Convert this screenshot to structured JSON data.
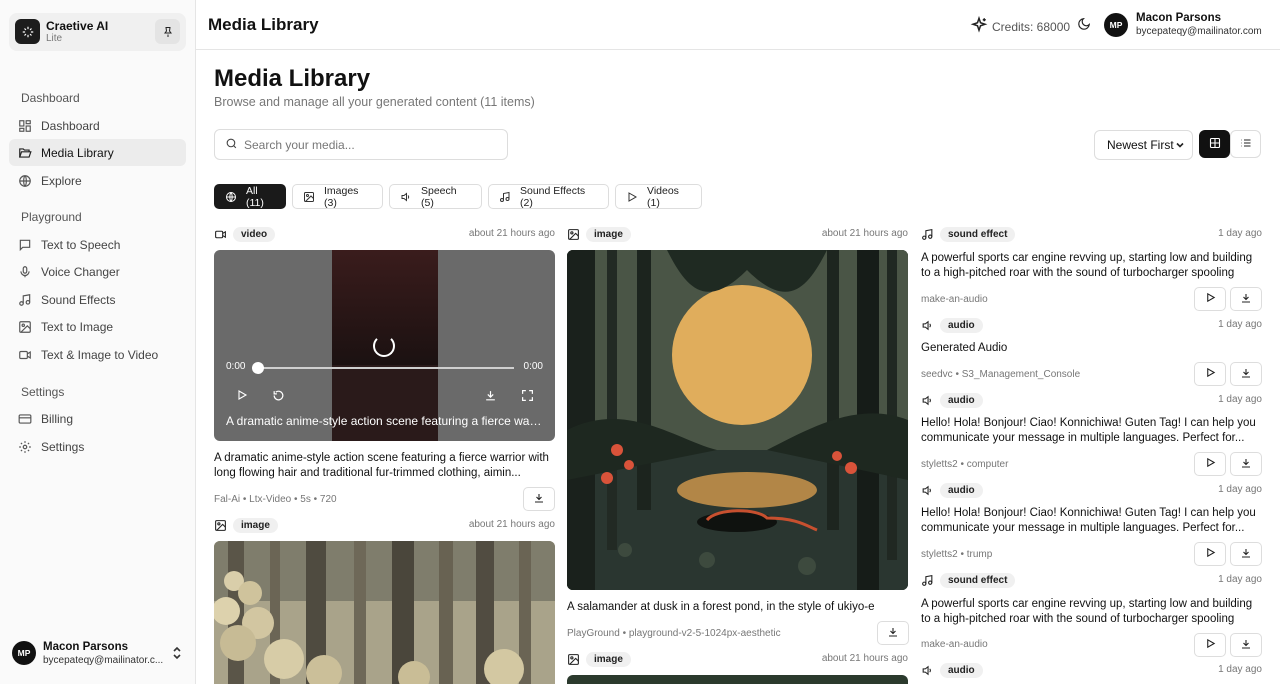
{
  "brand": {
    "name": "Craetive AI",
    "tier": "Lite"
  },
  "sidebar": {
    "sections": [
      {
        "label": "Dashboard"
      },
      {
        "label": "Playground"
      },
      {
        "label": "Settings"
      }
    ],
    "items": [
      {
        "label": "Dashboard",
        "icon": "grid-icon"
      },
      {
        "label": "Media Library",
        "icon": "folder-open-icon",
        "active": true
      },
      {
        "label": "Explore",
        "icon": "globe-icon"
      },
      {
        "label": "Text to Speech",
        "icon": "message-square-icon"
      },
      {
        "label": "Voice Changer",
        "icon": "mic-icon"
      },
      {
        "label": "Sound Effects",
        "icon": "music-icon"
      },
      {
        "label": "Text to Image",
        "icon": "image-icon"
      },
      {
        "label": "Text & Image to Video",
        "icon": "video-icon"
      },
      {
        "label": "Billing",
        "icon": "credit-card-icon"
      },
      {
        "label": "Settings",
        "icon": "gear-icon"
      }
    ]
  },
  "user": {
    "initials": "MP",
    "name": "Macon Parsons",
    "email": "bycepateqy@mailinator.com",
    "email_truncated": "bycepateqy@mailinator.c..."
  },
  "header": {
    "title": "Media Library",
    "credits": "Credits: 68000"
  },
  "main": {
    "title": "Media Library",
    "subtitle": "Browse and manage all your generated content (11 items)",
    "search_placeholder": "Search your media...",
    "sort_value": "Newest First",
    "filters": [
      {
        "label": "All (11)",
        "active": true
      },
      {
        "label": "Images (3)"
      },
      {
        "label": "Speech (5)"
      },
      {
        "label": "Sound Effects (2)"
      },
      {
        "label": "Videos (1)"
      }
    ]
  },
  "col1": {
    "video": {
      "type": "video",
      "time": "about 21 hours ago",
      "current": "0:00",
      "duration": "0:00",
      "overlay": "A dramatic anime-style action scene featuring a fierce warri...",
      "desc": "A dramatic anime-style action scene featuring a fierce warrior with long flowing hair and traditional fur-trimmed clothing, aimin...",
      "source": "Fal-Ai • Ltx-Video • 5s • 720"
    },
    "image": {
      "type": "image",
      "time": "about 21 hours ago"
    }
  },
  "col2": {
    "image": {
      "type": "image",
      "time": "about 21 hours ago",
      "desc": "A salamander at dusk in a forest pond, in the style of ukiyo-e",
      "source": "PlayGround • playground-v2-5-1024px-aesthetic"
    },
    "image2": {
      "type": "image",
      "time": "about 21 hours ago"
    }
  },
  "col3": [
    {
      "type": "sound effect",
      "time": "1 day ago",
      "desc": "A powerful sports car engine revving up, starting low and building to a high-pitched roar with the sound of turbocharger spooling",
      "source": "make-an-audio"
    },
    {
      "type": "audio",
      "time": "1 day ago",
      "desc": "Generated Audio",
      "source": "seedvc • S3_Management_Console"
    },
    {
      "type": "audio",
      "time": "1 day ago",
      "desc": "Hello! Hola! Bonjour! Ciao! Konnichiwa! Guten Tag! I can help you communicate your message in multiple languages. Perfect for...",
      "source": "styletts2 • computer"
    },
    {
      "type": "audio",
      "time": "1 day ago",
      "desc": "Hello! Hola! Bonjour! Ciao! Konnichiwa! Guten Tag! I can help you communicate your message in multiple languages. Perfect for...",
      "source": "styletts2 • trump"
    },
    {
      "type": "sound effect",
      "time": "1 day ago",
      "desc": "A powerful sports car engine revving up, starting low and building to a high-pitched roar with the sound of turbocharger spooling",
      "source": "make-an-audio"
    },
    {
      "type": "audio",
      "time": "1 day ago"
    }
  ]
}
